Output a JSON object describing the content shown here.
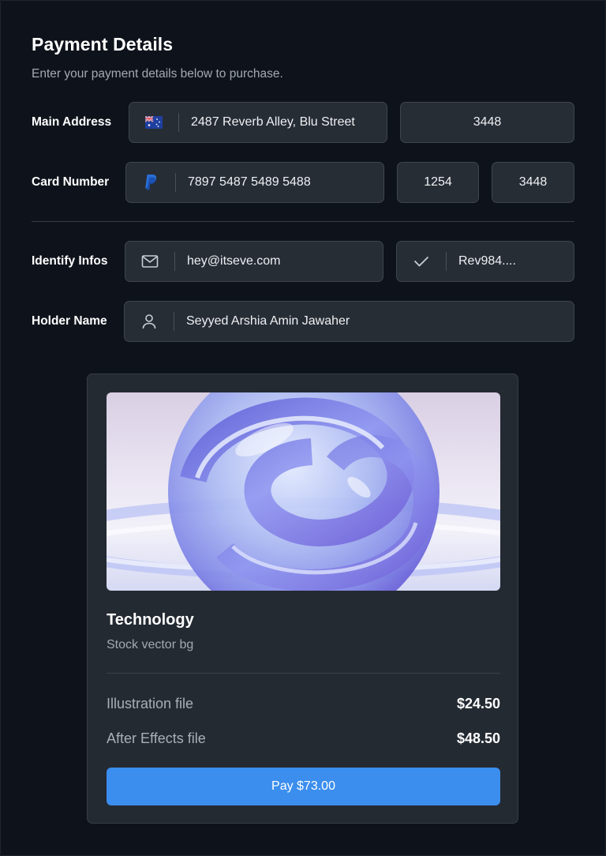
{
  "header": {
    "title": "Payment Details",
    "subtitle": "Enter your payment details below to purchase."
  },
  "form": {
    "main_address": {
      "label": "Main Address",
      "icon": "australia-flag-icon",
      "address": "2487 Reverb Alley, Blu Street",
      "code": "3448"
    },
    "card_number": {
      "label": "Card Number",
      "icon": "paypal-icon",
      "number": "7897 5487 5489 5488",
      "field2": "1254",
      "field3": "3448"
    },
    "identify_infos": {
      "label": "Identify Infos",
      "icon": "mail-icon",
      "email": "hey@itseve.com",
      "check_icon": "check-icon",
      "reference": "Rev984...."
    },
    "holder_name": {
      "label": "Holder Name",
      "icon": "user-icon",
      "name": "Seyyed Arshia Amin Jawaher"
    }
  },
  "product": {
    "title": "Technology",
    "subtitle": "Stock vector bg",
    "items": [
      {
        "name": "Illustration file",
        "price": "$24.50"
      },
      {
        "name": "After Effects file",
        "price": "$48.50"
      }
    ],
    "pay_label": "Pay $73.00"
  },
  "colors": {
    "background": "#0e131b",
    "field": "#272d35",
    "card": "#242a32",
    "accent": "#3b8eee"
  }
}
